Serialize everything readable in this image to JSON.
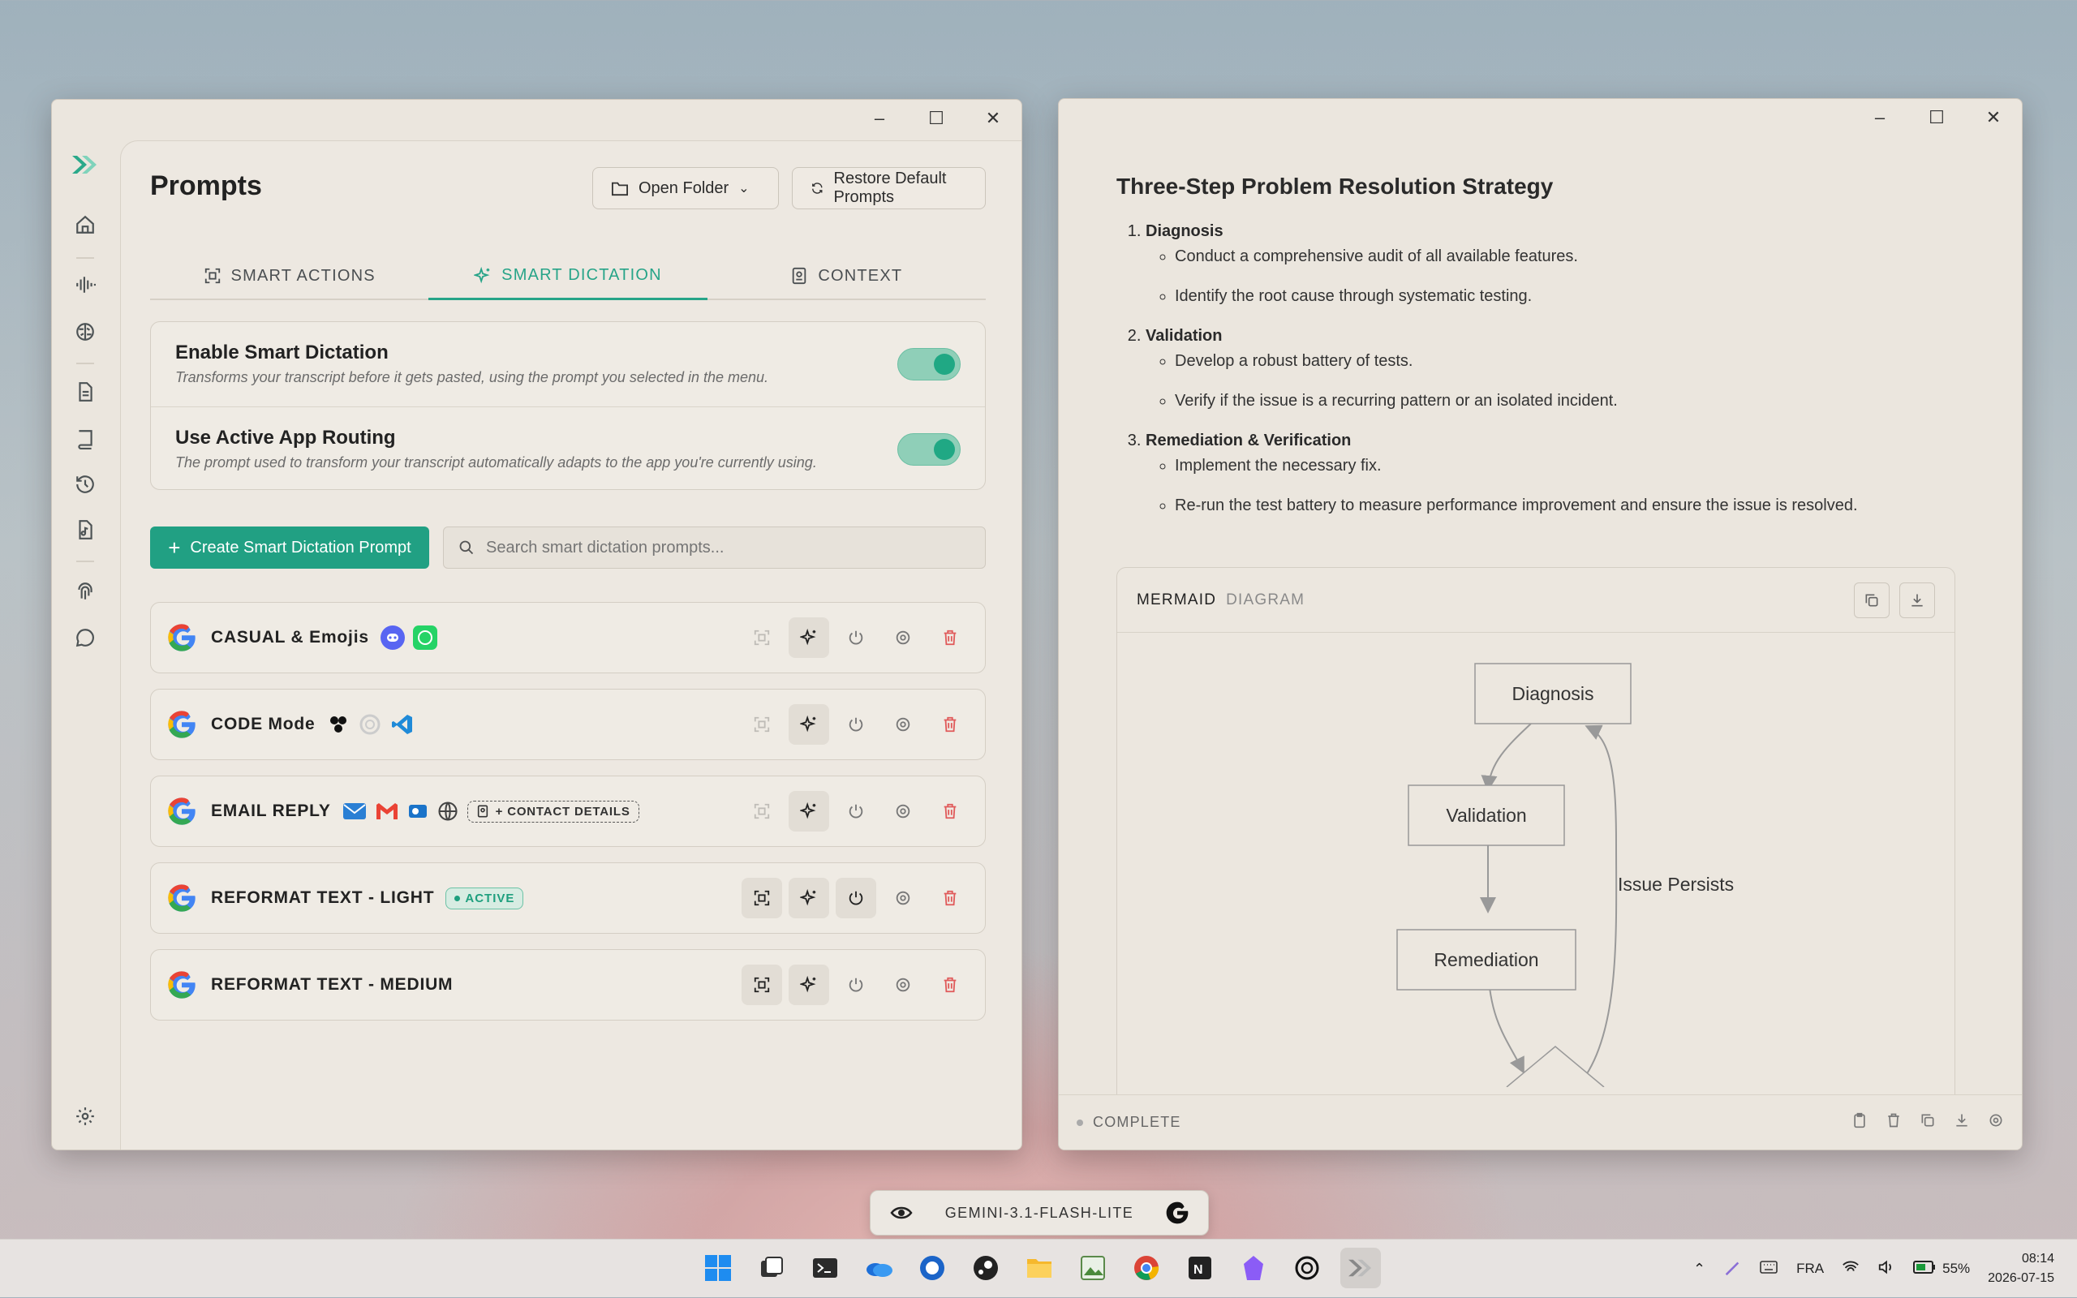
{
  "left_window": {
    "title": "Prompts",
    "open_folder_label": "Open Folder",
    "restore_label": "Restore Default Prompts",
    "tabs": [
      {
        "label": "SMART ACTIONS",
        "active": false
      },
      {
        "label": "SMART DICTATION",
        "active": true
      },
      {
        "label": "CONTEXT",
        "active": false
      }
    ],
    "settings": [
      {
        "title": "Enable Smart Dictation",
        "desc": "Transforms your transcript before it gets pasted, using the prompt you selected in the menu.",
        "on": true
      },
      {
        "title": "Use Active App Routing",
        "desc": "The prompt used to transform your transcript automatically adapts to the app you're currently using.",
        "on": true
      }
    ],
    "create_label": "Create Smart Dictation Prompt",
    "search_placeholder": "Search smart dictation prompts...",
    "prompts": [
      {
        "name": "CASUAL & Emojis",
        "apps": [
          "discord-icon",
          "whatsapp-icon"
        ]
      },
      {
        "name": "CODE Mode",
        "apps": [
          "app-icon",
          "openai-icon",
          "vscode-icon"
        ]
      },
      {
        "name": "EMAIL REPLY",
        "apps": [
          "mail-icon",
          "gmail-icon",
          "outlook-icon",
          "globe-icon"
        ],
        "chip": "+ CONTACT DETAILS"
      },
      {
        "name": "REFORMAT TEXT - LIGHT",
        "badge": "ACTIVE"
      },
      {
        "name": "REFORMAT TEXT - MEDIUM"
      }
    ],
    "accent": "#21a083"
  },
  "right_window": {
    "doc_title": "Three-Step Problem Resolution Strategy",
    "steps": [
      {
        "title": "Diagnosis",
        "items": [
          "Conduct a comprehensive audit of all available features.",
          "Identify the root cause through systematic testing."
        ]
      },
      {
        "title": "Validation",
        "items": [
          "Develop a robust battery of tests.",
          "Verify if the issue is a recurring pattern or an isolated incident."
        ]
      },
      {
        "title": "Remediation & Verification",
        "items": [
          "Implement the necessary fix.",
          "Re-run the test battery to measure performance improvement and ensure the issue is resolved."
        ]
      }
    ],
    "mermaid_label": "MERMAID",
    "diagram_label": "DIAGRAM",
    "nodes": {
      "diagnosis": "Diagnosis",
      "validation": "Validation",
      "remediation": "Remediation"
    },
    "edge_label": "Issue Persists",
    "status": "COMPLETE"
  },
  "model_pill": {
    "label": "GEMINI-3.1-FLASH-LITE"
  },
  "taskbar": {
    "language": "FRA",
    "battery": "55%",
    "time": "08:14",
    "date": "2026-07-15"
  }
}
